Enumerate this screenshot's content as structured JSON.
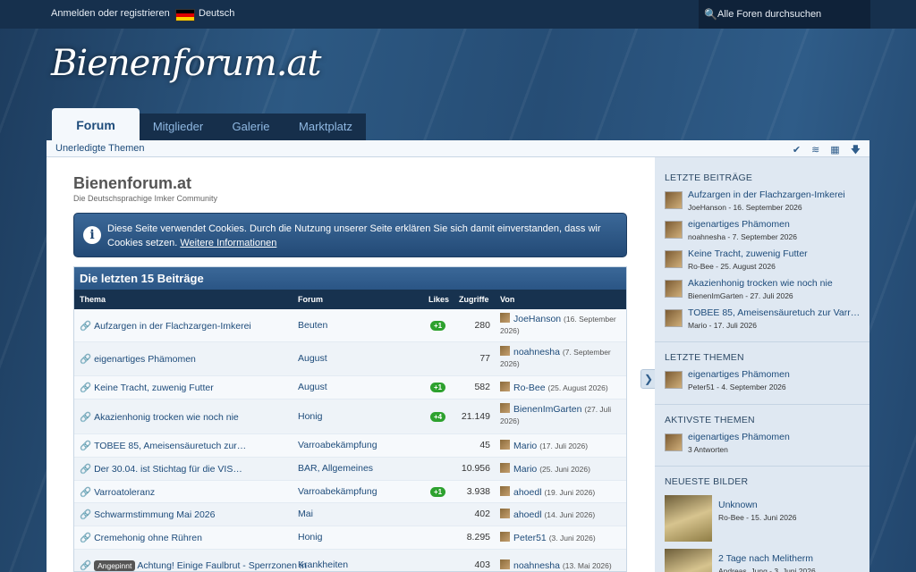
{
  "topbar": {
    "login": "Anmelden oder registrieren",
    "language": "Deutsch",
    "search_placeholder": "Alle Foren durchsuchen"
  },
  "logo": "Bienenforum.at",
  "tabs": [
    "Forum",
    "Mitglieder",
    "Galerie",
    "Marktplatz"
  ],
  "subnav": {
    "unread": "Unerledigte Themen",
    "icons": [
      "check-icon",
      "rss-icon",
      "sitemap-icon",
      "arrow-down-icon"
    ]
  },
  "page": {
    "title": "Bienenforum.at",
    "subtitle": "Die Deutschsprachige Imker Community"
  },
  "notice": {
    "text": "Diese Seite verwendet Cookies. Durch die Nutzung unserer Seite erklären Sie sich damit einverstanden, dass wir Cookies setzen.",
    "link": "Weitere Informationen"
  },
  "latest": {
    "title": "Die letzten 15 Beiträge",
    "columns": {
      "thema": "Thema",
      "forum": "Forum",
      "likes": "Likes",
      "zugriffe": "Zugriffe",
      "von": "Von"
    },
    "rows": [
      {
        "title": "Aufzargen in der Flachzargen-Imkerei",
        "forum": "Beuten",
        "likes": "+1",
        "views": "280",
        "user": "JoeHanson",
        "date": "16. September 2026"
      },
      {
        "title": "eigenartiges Phämomen",
        "forum": "August",
        "likes": "",
        "views": "77",
        "user": "noahnesha",
        "date": "7. September 2026"
      },
      {
        "title": "Keine Tracht, zuwenig Futter",
        "forum": "August",
        "likes": "+1",
        "views": "582",
        "user": "Ro-Bee",
        "date": "25. August 2026"
      },
      {
        "title": "Akazienhonig trocken wie noch nie",
        "forum": "Honig",
        "likes": "+4",
        "views": "21.149",
        "user": "BienenImGarten",
        "date": "27. Juli 2026"
      },
      {
        "title": "TOBEE 85, Ameisensäuretuch zur…",
        "forum": "Varroabekämpfung",
        "likes": "",
        "views": "45",
        "user": "Mario",
        "date": "17. Juli 2026"
      },
      {
        "title": "Der 30.04. ist Stichtag für die VIS…",
        "forum": "BAR, Allgemeines",
        "likes": "",
        "views": "10.956",
        "user": "Mario",
        "date": "25. Juni 2026"
      },
      {
        "title": "Varroatoleranz",
        "forum": "Varroabekämpfung",
        "likes": "+1",
        "views": "3.938",
        "user": "ahoedl",
        "date": "19. Juni 2026"
      },
      {
        "title": "Schwarmstimmung Mai 2026",
        "forum": "Mai",
        "likes": "",
        "views": "402",
        "user": "ahoedl",
        "date": "14. Juni 2026"
      },
      {
        "title": "Cremehonig ohne Rühren",
        "forum": "Honig",
        "likes": "",
        "views": "8.295",
        "user": "Peter51",
        "date": "3. Juni 2026"
      },
      {
        "tag": "Angepinnt",
        "title": "Achtung! Einige Faulbrut - Sperrzonen in",
        "forum": "Krankheiten",
        "likes": "",
        "views": "403",
        "user": "noahnesha",
        "date": "13. Mai 2026"
      }
    ]
  },
  "sidebar": {
    "recent_posts": {
      "title": "LETZTE BEITRÄGE",
      "items": [
        {
          "title": "Aufzargen in der Flachzargen-Imkerei",
          "meta": "JoeHanson - 16. September 2026"
        },
        {
          "title": "eigenartiges Phämomen",
          "meta": "noahnesha - 7. September 2026"
        },
        {
          "title": "Keine Tracht, zuwenig Futter",
          "meta": "Ro-Bee - 25. August 2026"
        },
        {
          "title": "Akazienhonig trocken wie noch nie",
          "meta": "BienenImGarten - 27. Juli 2026"
        },
        {
          "title": "TOBEE 85, Ameisensäuretuch zur Varr…",
          "meta": "Mario - 17. Juli 2026"
        }
      ]
    },
    "recent_threads": {
      "title": "LETZTE THEMEN",
      "items": [
        {
          "title": "eigenartiges Phämomen",
          "meta": "Peter51 - 4. September 2026"
        }
      ]
    },
    "active_threads": {
      "title": "AKTIVSTE THEMEN",
      "items": [
        {
          "title": "eigenartiges Phämomen",
          "meta": "3 Antworten"
        }
      ]
    },
    "new_images": {
      "title": "NEUESTE BILDER",
      "items": [
        {
          "title": "Unknown",
          "meta": "Ro-Bee - 15. Juni 2026"
        },
        {
          "title": "2 Tage nach Melitherm",
          "meta": "Andreas_Jung - 3. Juni 2026"
        }
      ]
    }
  }
}
